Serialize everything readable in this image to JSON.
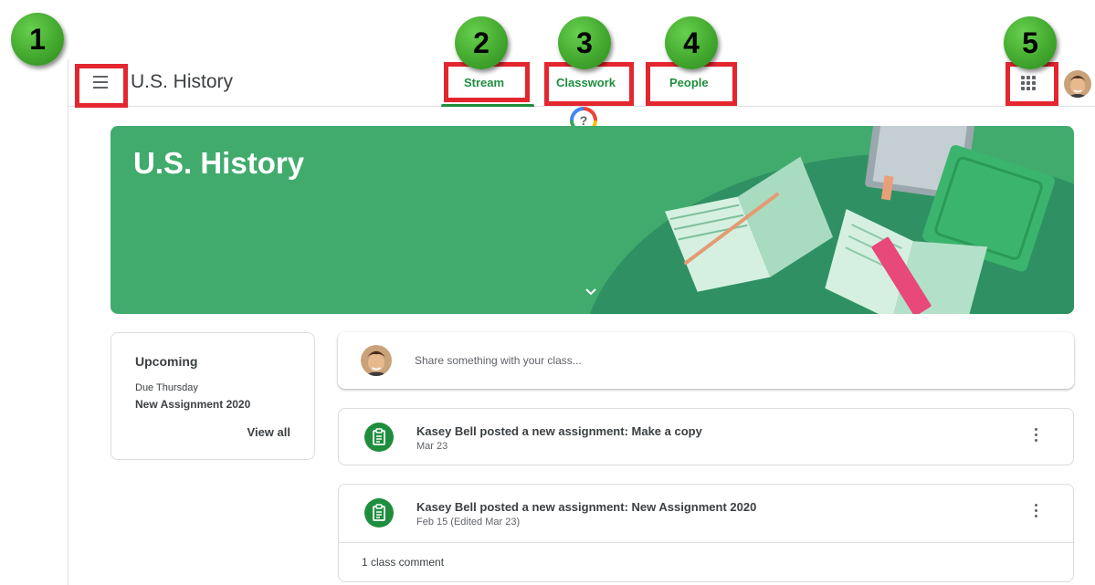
{
  "header": {
    "class_title": "U.S. History",
    "tabs": [
      {
        "label": "Stream",
        "active": true
      },
      {
        "label": "Classwork",
        "active": false
      },
      {
        "label": "People",
        "active": false
      }
    ],
    "help_glyph": "?"
  },
  "banner": {
    "title": "U.S. History",
    "color": "#41ab6d"
  },
  "upcoming": {
    "title": "Upcoming",
    "due_label": "Due Thursday",
    "item": "New Assignment 2020",
    "view_all": "View all"
  },
  "share": {
    "placeholder": "Share something with your class..."
  },
  "posts": [
    {
      "title": "Kasey Bell posted a new assignment: Make a copy",
      "date": "Mar 23"
    },
    {
      "title": "Kasey Bell posted a new assignment: New Assignment 2020",
      "date": "Feb 15 (Edited Mar 23)",
      "comments": "1 class comment"
    }
  ],
  "callouts": [
    "1",
    "2",
    "3",
    "4",
    "5"
  ],
  "colors": {
    "accent": "#1e8e3e",
    "callout_border": "#e4262f",
    "callout_badge": "#43a92f"
  },
  "icons": {
    "menu": "hamburger-menu-icon",
    "apps": "apps-grid-icon",
    "help": "help-icon",
    "assignment": "assignment-icon",
    "more": "more-vert-icon",
    "chevron": "chevron-down-icon"
  }
}
